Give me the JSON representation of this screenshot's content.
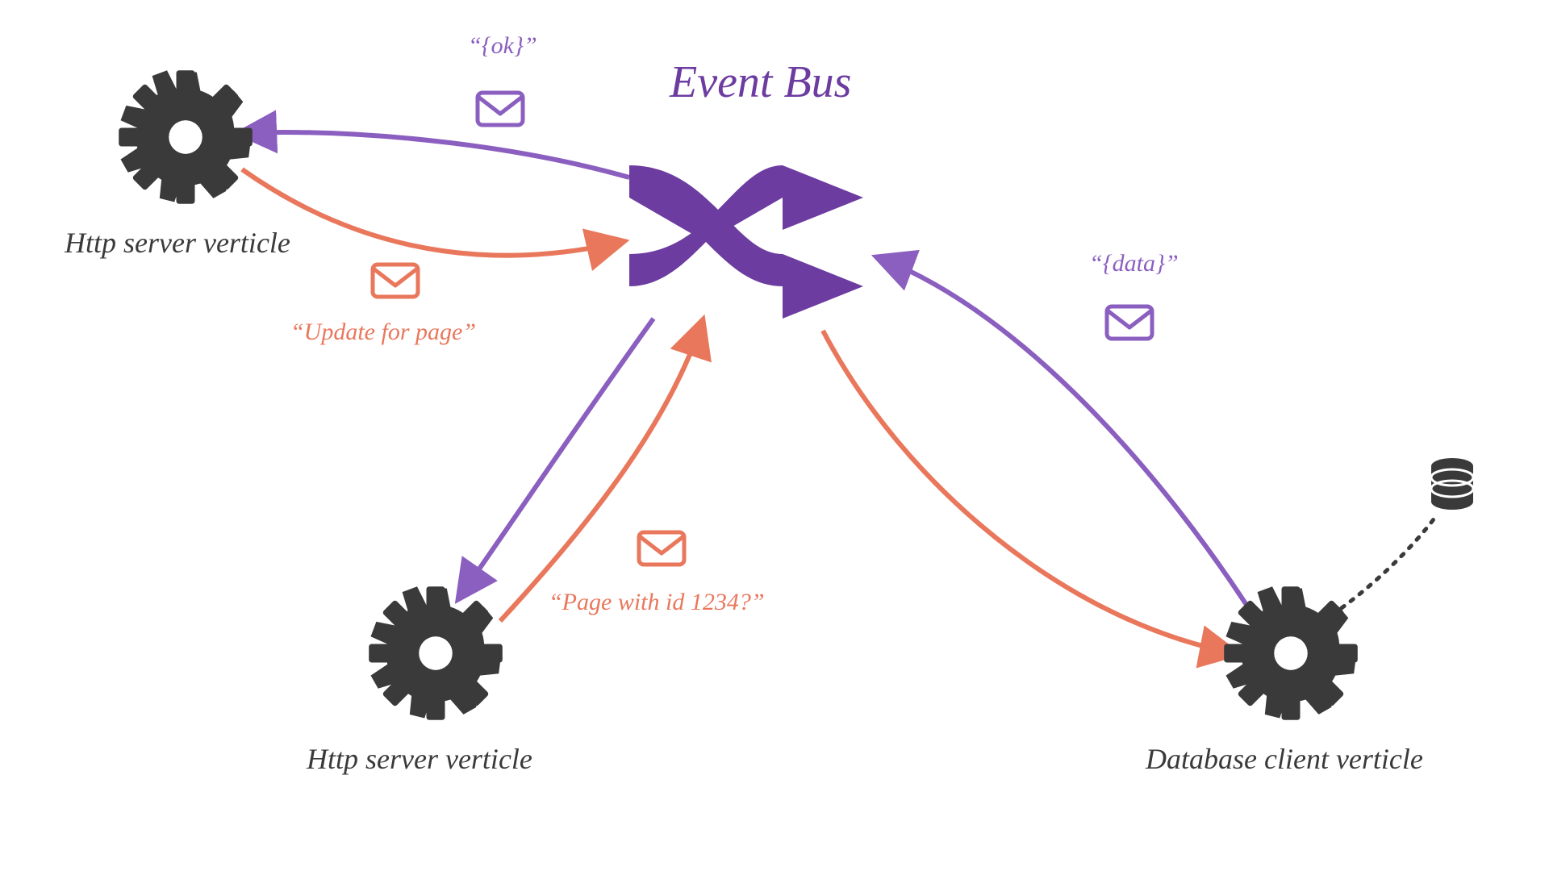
{
  "title": "Event Bus",
  "nodes": {
    "http_top": {
      "label": "Http server verticle"
    },
    "http_bottom": {
      "label": "Http server verticle"
    },
    "db_client": {
      "label": "Database client verticle"
    }
  },
  "messages": {
    "ok": {
      "text": "“{ok}”"
    },
    "update": {
      "text": "“Update for page”"
    },
    "page_id": {
      "text": "“Page with id 1234?”"
    },
    "data": {
      "text": "“{data}”"
    }
  },
  "colors": {
    "orange": "#E9775C",
    "purple": "#8B5FBF",
    "brand_purple": "#6C3CA0",
    "gear": "#3A3A3A"
  }
}
